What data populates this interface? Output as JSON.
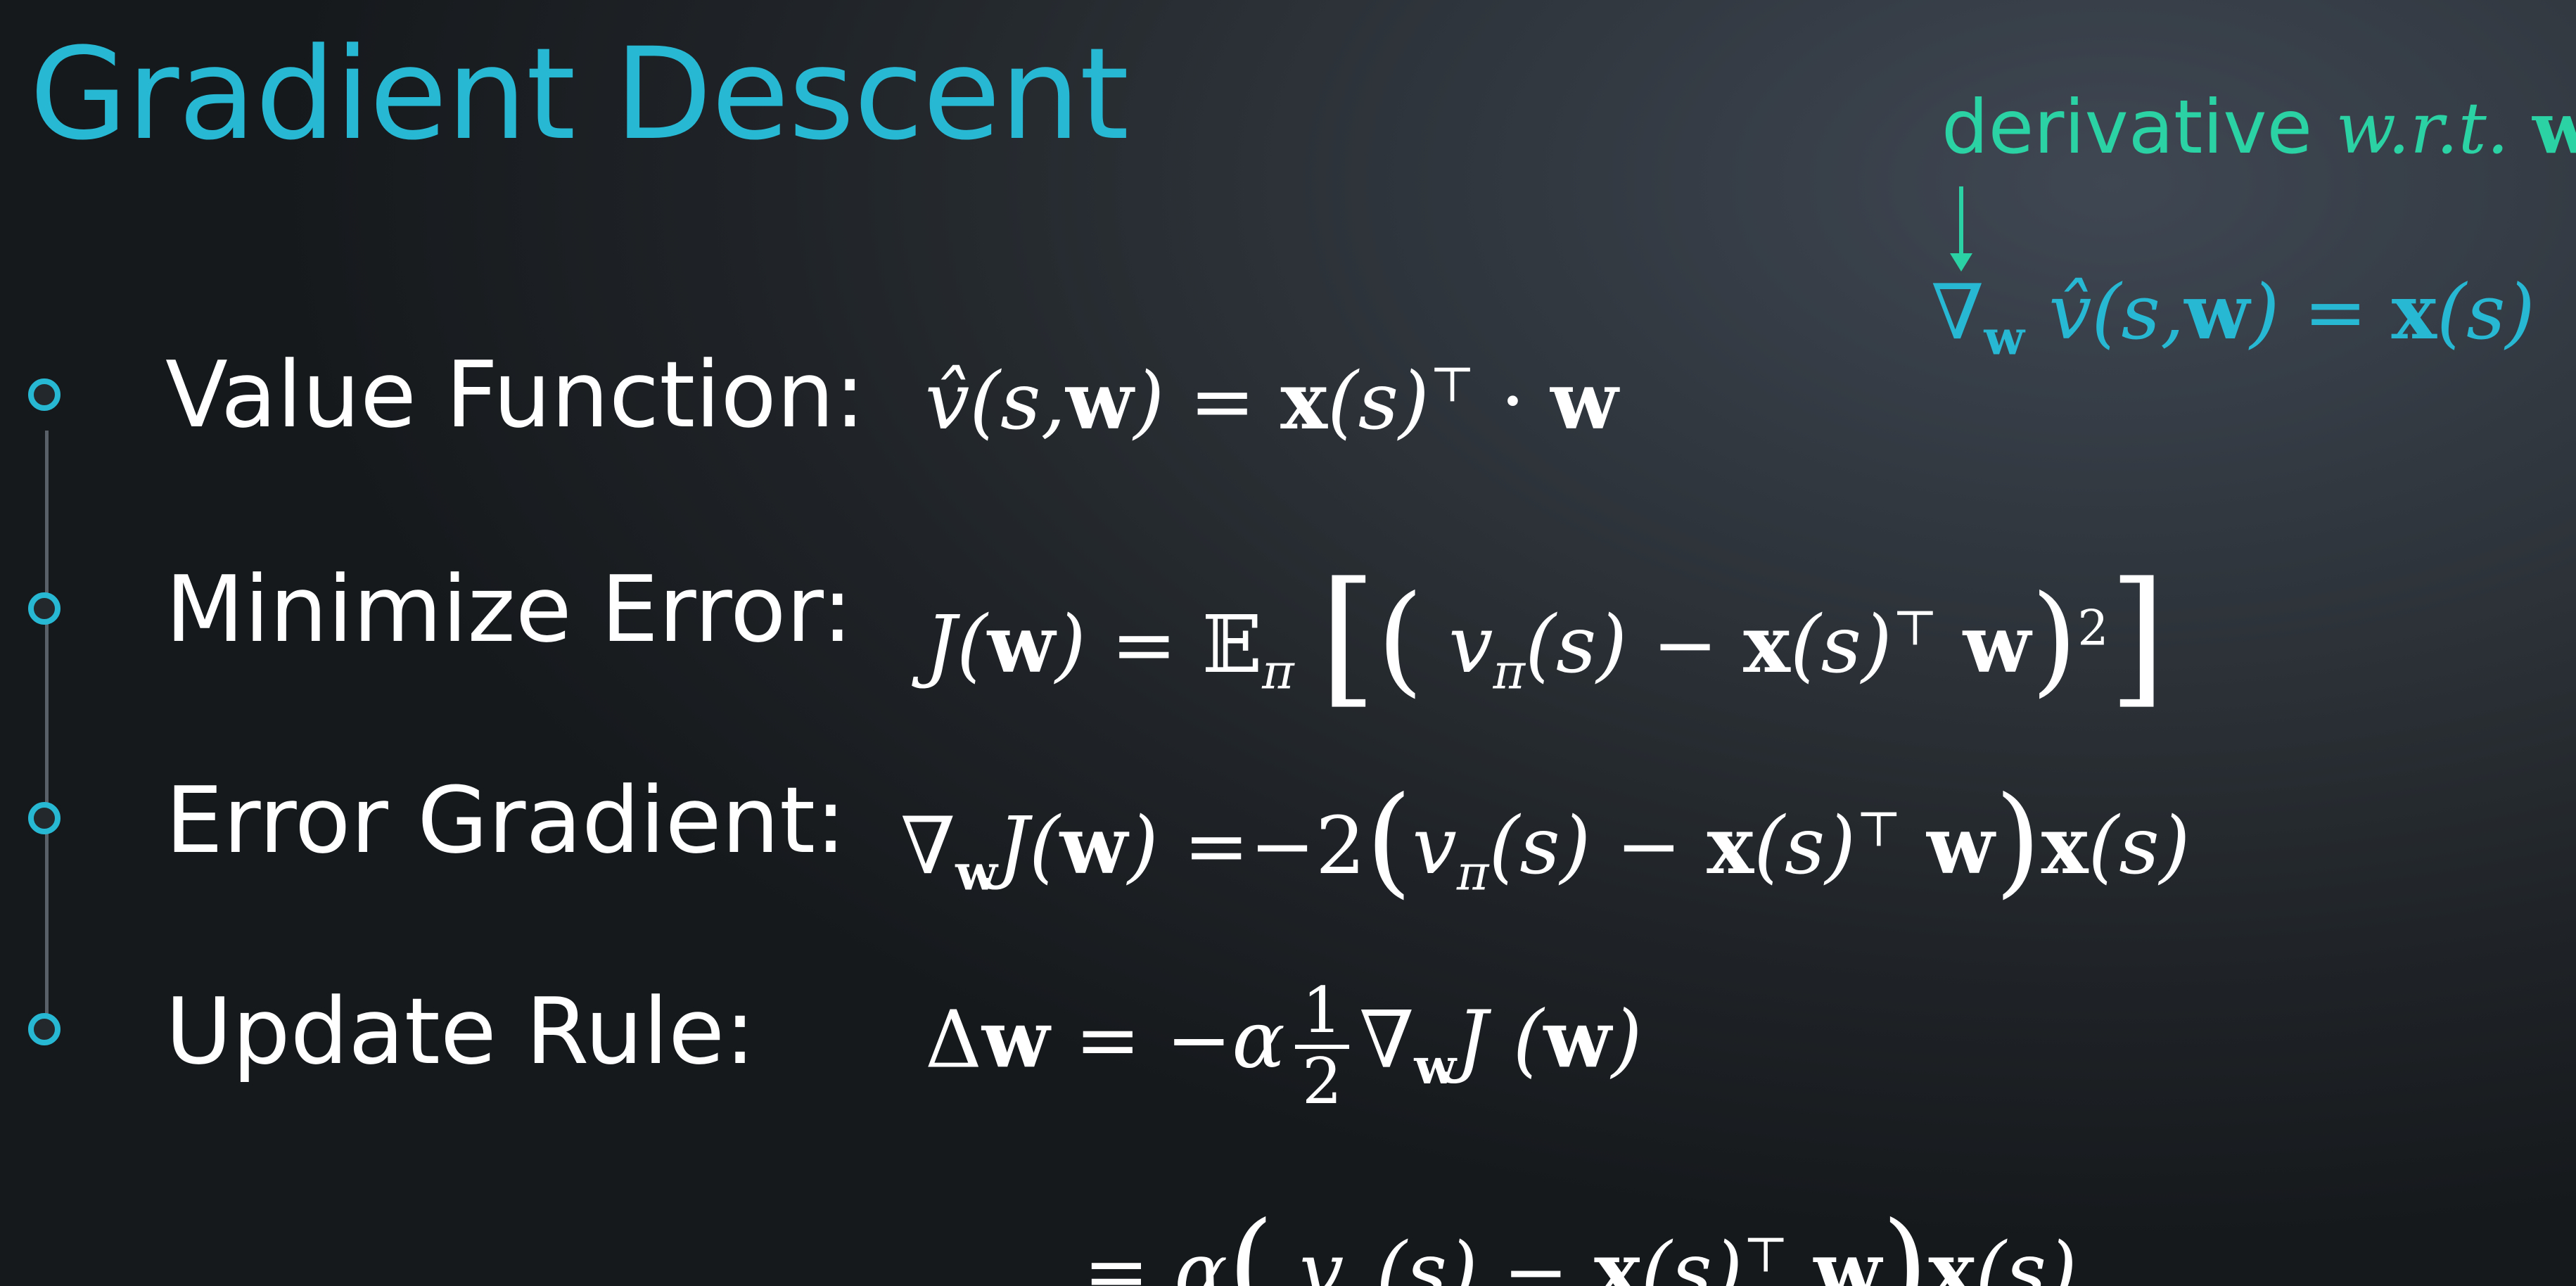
{
  "slide": {
    "title": "Gradient Descent",
    "accent_color": "#27b9d4",
    "annotation_color": "#2bd2a3",
    "background_color": "#23282d"
  },
  "annotation": {
    "text": "derivative",
    "wrt": "w.r.t.",
    "variable": "w",
    "arrow_icon": "down-arrow",
    "formula": "∇w v̂(s,w) = x(s)"
  },
  "bullets": [
    {
      "label": "Value Function:",
      "formula": "v̂(s,w) = x(s)ᵀ · w",
      "icon": "circle-bullet"
    },
    {
      "label": "Minimize Error:",
      "formula": "J(w) = 𝔼π[(vπ(s) − x(s)ᵀw)²]",
      "icon": "circle-bullet"
    },
    {
      "label": "Error Gradient:",
      "formula": "∇wJ(w) = −2(vπ(s) − x(s)ᵀw)x(s)",
      "icon": "circle-bullet"
    },
    {
      "label": "Update Rule:",
      "formula": "Δw = −α ½ ∇wJ(w)",
      "icon": "circle-bullet"
    }
  ],
  "continuation_formula": "= α(vπ(s) − x(s)ᵀw)x(s)"
}
